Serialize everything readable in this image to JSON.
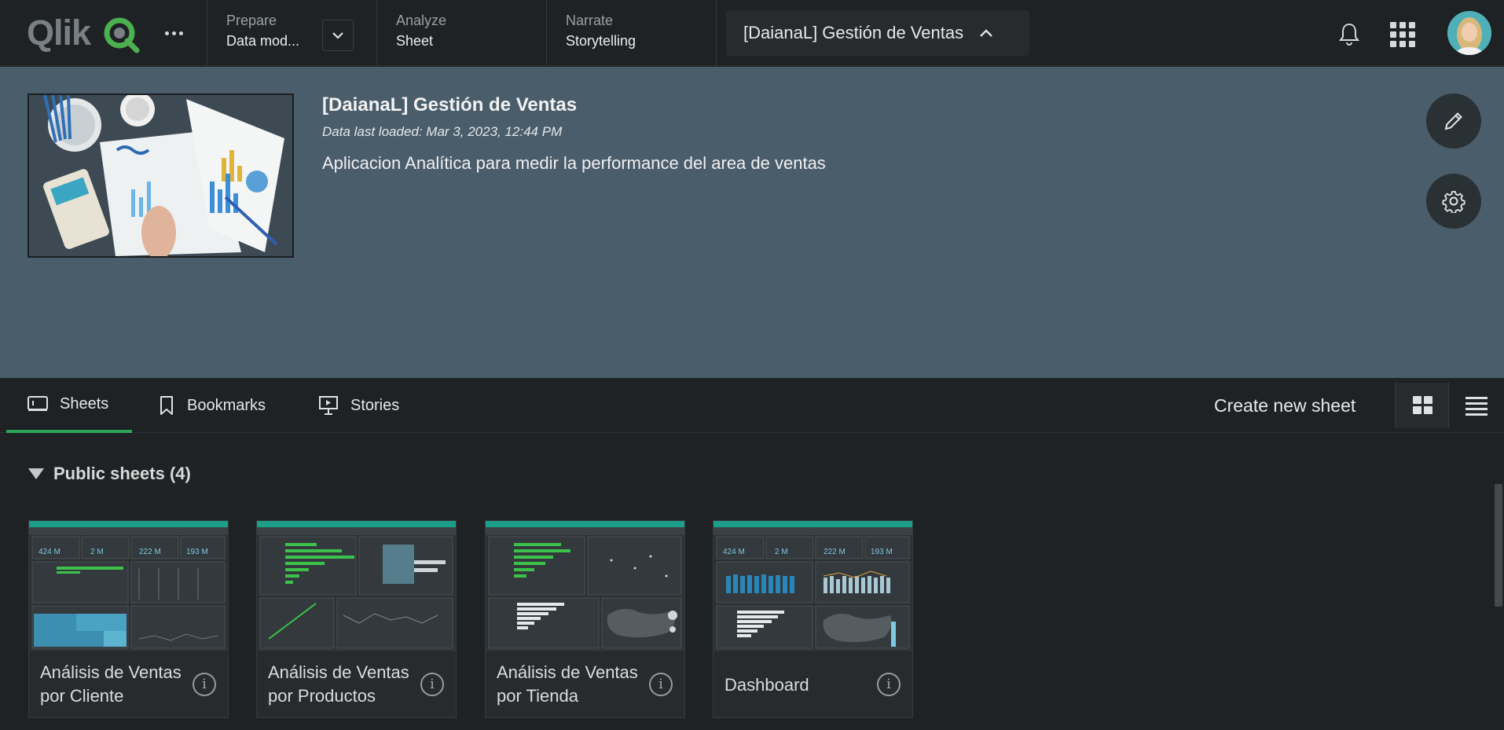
{
  "topbar": {
    "logo_text": "Qlik",
    "prepare": {
      "label": "Prepare",
      "value": "Data mod..."
    },
    "analyze": {
      "label": "Analyze",
      "value": "Sheet"
    },
    "narrate": {
      "label": "Narrate",
      "value": "Storytelling"
    },
    "app_name": "[DaianaL] Gestión de Ventas"
  },
  "app": {
    "title": "[DaianaL] Gestión de Ventas",
    "last_loaded": "Data last loaded: Mar 3, 2023, 12:44 PM",
    "description": "Aplicacion Analítica para medir la performance del area de ventas"
  },
  "tabs": {
    "sheets": "Sheets",
    "bookmarks": "Bookmarks",
    "stories": "Stories"
  },
  "toolbar": {
    "create_sheet": "Create new sheet"
  },
  "section": {
    "title": "Public sheets (4)"
  },
  "sheets": [
    {
      "title": "Análisis de Ventas por Cliente",
      "kpis": [
        "424 M",
        "2 M",
        "222 M",
        "193 M"
      ]
    },
    {
      "title": "Análisis de Ventas por Productos"
    },
    {
      "title": "Análisis de Ventas por Tienda"
    },
    {
      "title": "Dashboard",
      "kpis": [
        "424 M",
        "2 M",
        "222 M",
        "193 M"
      ]
    }
  ],
  "colors": {
    "accent_green": "#2ca35a",
    "header_bg": "#4a5d6b",
    "qlik_green": "#4cb050"
  }
}
